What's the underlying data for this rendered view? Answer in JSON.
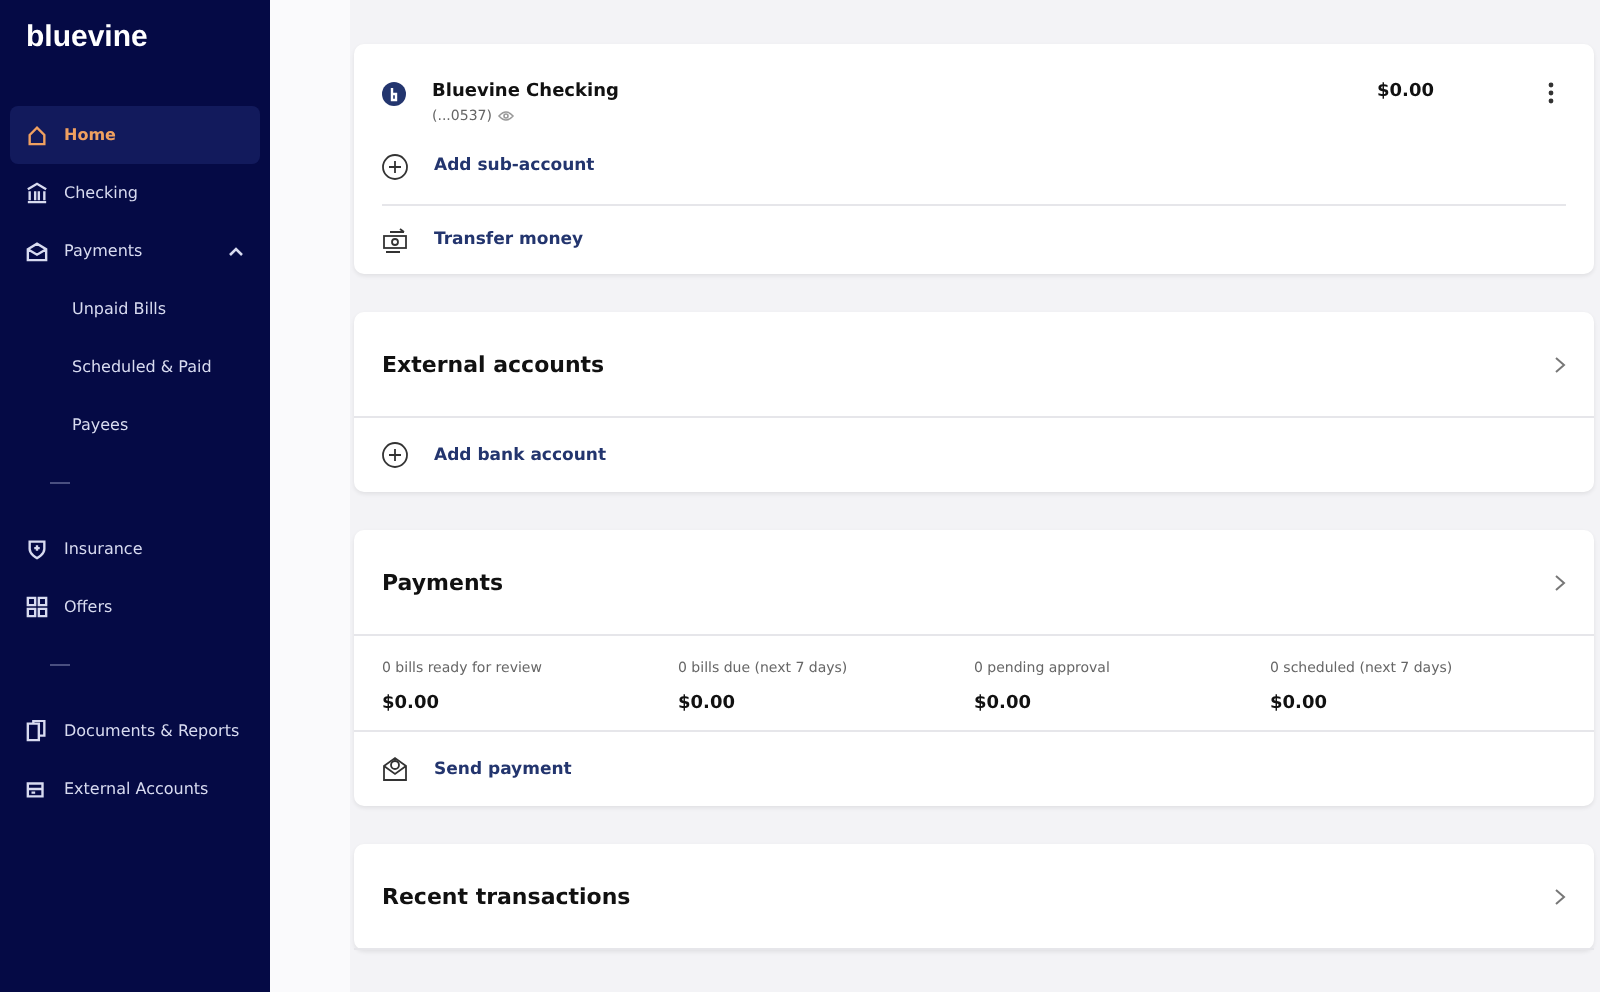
{
  "sidebar": {
    "logo": "bluevine",
    "items": [
      {
        "kind": "item",
        "label": "Home",
        "selected": true
      },
      {
        "kind": "item",
        "label": "Checking",
        "selected": false
      },
      {
        "kind": "group",
        "label": "Payments",
        "selected": false,
        "expanded": true
      },
      {
        "kind": "sub",
        "label": "Unpaid Bills",
        "selected": false
      },
      {
        "kind": "sub",
        "label": "Scheduled & Paid",
        "selected": false
      },
      {
        "kind": "sub",
        "label": "Payees",
        "selected": false
      },
      {
        "kind": "divider"
      },
      {
        "kind": "item",
        "label": "Insurance",
        "selected": false
      },
      {
        "kind": "item",
        "label": "Offers",
        "selected": false
      },
      {
        "kind": "divider"
      },
      {
        "kind": "item",
        "label": "Documents & Reports",
        "selected": false
      },
      {
        "kind": "item",
        "label": "External Accounts",
        "selected": false
      }
    ]
  },
  "account_card": {
    "name": "Bluevine Checking",
    "number": "(...0537)",
    "balance": "$0.00",
    "add_action": "Add sub-account",
    "transfer_action": "Transfer money"
  },
  "external_accounts": {
    "title": "External accounts",
    "action": "Add bank account"
  },
  "payments": {
    "title": "Payments",
    "stats": [
      {
        "label": "0 bills ready for review",
        "amount": "$0.00"
      },
      {
        "label": "0 bills due (next 7 days)",
        "amount": "$0.00"
      },
      {
        "label": "0 pending approval",
        "amount": "$0.00"
      },
      {
        "label": "0 scheduled (next 7 days)",
        "amount": "$0.00"
      }
    ],
    "action": "Send payment"
  },
  "recent_transactions": {
    "title": "Recent transactions"
  }
}
